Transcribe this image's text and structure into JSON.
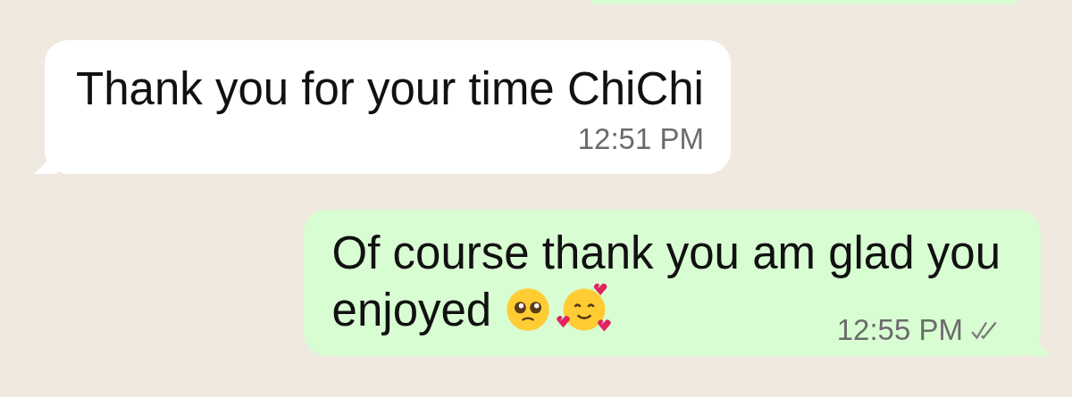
{
  "messages": [
    {
      "kind": "received",
      "lines": [
        "Thank you for your time ChiChi"
      ],
      "time": "12:51 PM"
    },
    {
      "kind": "sent",
      "lines": [
        "Of course thank you am glad you",
        "enjoyed"
      ],
      "emojis": [
        {
          "kind": "pleading"
        },
        {
          "kind": "hearts"
        }
      ],
      "time": "12:55 PM",
      "read": false
    }
  ]
}
